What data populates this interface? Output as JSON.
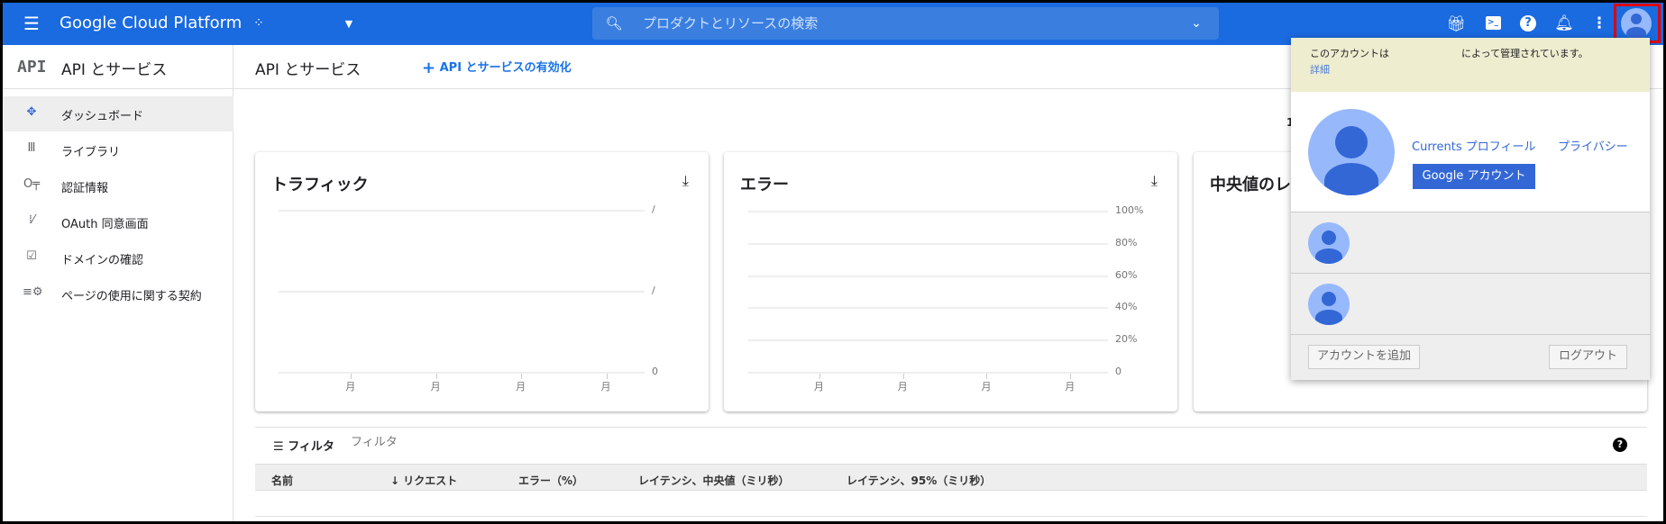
{
  "header": {
    "app_title": "Google Cloud Platform",
    "search_placeholder": "プロダクトとリソースの検索",
    "icons": [
      "menu-icon",
      "project-icon",
      "dropdown-icon",
      "search-icon",
      "expand-icon",
      "gift-icon",
      "terminal-icon",
      "help-icon",
      "bell-icon",
      "more-icon",
      "avatar"
    ]
  },
  "sidebar": {
    "logo": "API",
    "title": "API とサービス",
    "items": [
      {
        "label": "ダッシュボード",
        "icon": "dashboard-icon",
        "selected": true
      },
      {
        "label": "ライブラリ",
        "icon": "library-icon"
      },
      {
        "label": "認証情報",
        "icon": "key-icon"
      },
      {
        "label": "OAuth 同意画面",
        "icon": "consent-icon"
      },
      {
        "label": "ドメインの確認",
        "icon": "checkbox-icon"
      },
      {
        "label": "ページの使用に関する契約",
        "icon": "settings-list-icon"
      }
    ]
  },
  "main": {
    "title": "API とサービス",
    "enable_label": "API とサービスの有効化",
    "partial_number": "1",
    "filter": {
      "label": "フィルタ",
      "placeholder": "フィルタ"
    },
    "table": {
      "columns": [
        "名前",
        "リクエスト",
        "エラー（%）",
        "レイテンシ、中央値（ミリ秒）",
        "レイテンシ、95%（ミリ秒）"
      ],
      "sort_column": "リクエスト",
      "rows": []
    }
  },
  "chart_data": [
    {
      "type": "line",
      "title": "トラフィック",
      "series": [],
      "y_tick_labels": [
        "/",
        "/",
        "0"
      ],
      "x_tick_labels": [
        "月",
        "月",
        "月",
        "月"
      ],
      "grid": true
    },
    {
      "type": "line",
      "title": "エラー",
      "series": [],
      "y_tick_labels": [
        "100%",
        "80%",
        "60%",
        "40%",
        "20%",
        "0"
      ],
      "ylim": [
        0,
        100
      ],
      "x_tick_labels": [
        "月",
        "月",
        "月",
        "月"
      ],
      "grid": true
    },
    {
      "type": "line",
      "title": "中央値のレ",
      "series": []
    }
  ],
  "account_menu": {
    "managed_prefix": "このアカウントは",
    "managed_suffix": "によって管理されています。",
    "details_link": "詳細",
    "currents_link": "Currents プロフィール",
    "privacy_link": "プライバシー",
    "google_account_button": "Google アカウント",
    "add_account_button": "アカウントを追加",
    "logout_button": "ログアウト"
  },
  "colors": {
    "header": "#1a6ae0",
    "accent": "#3367d6",
    "banner": "#efedcf",
    "highlight": "#e00000"
  }
}
